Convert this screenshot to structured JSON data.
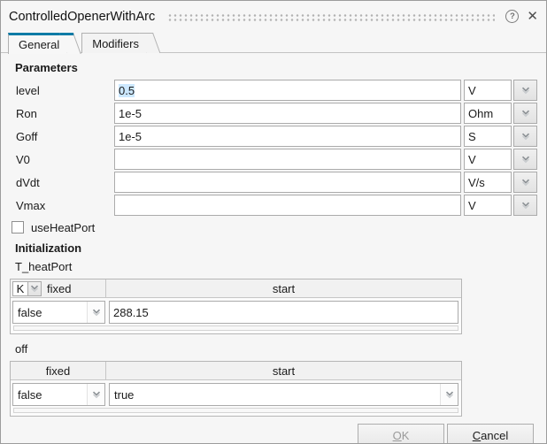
{
  "window": {
    "title": "ControlledOpenerWithArc"
  },
  "icons": {
    "help": "?",
    "close": "✕"
  },
  "tabs": {
    "general": "General",
    "modifiers": "Modifiers"
  },
  "sections": {
    "parameters": "Parameters",
    "initialization": "Initialization"
  },
  "params": [
    {
      "label": "level",
      "value": "0.5",
      "unit": "V",
      "value_selected": true
    },
    {
      "label": "Ron",
      "value": "1e-5",
      "unit": "Ohm",
      "value_selected": false
    },
    {
      "label": "Goff",
      "value": "1e-5",
      "unit": "S",
      "value_selected": false
    },
    {
      "label": "V0",
      "value": "",
      "unit": "V",
      "value_selected": false
    },
    {
      "label": "dVdt",
      "value": "",
      "unit": "V/s",
      "value_selected": false
    },
    {
      "label": "Vmax",
      "value": "",
      "unit": "V",
      "value_selected": false
    }
  ],
  "use_heat_port": {
    "label": "useHeatPort",
    "checked": false
  },
  "t_heat_port": {
    "label": "T_heatPort",
    "unit": "K",
    "col_fixed": "fixed",
    "col_start": "start",
    "fixed_value": "false",
    "start_value": "288.15"
  },
  "off_var": {
    "label": "off",
    "col_fixed": "fixed",
    "col_start": "start",
    "fixed_value": "false",
    "start_value": "true"
  },
  "buttons": {
    "ok": "OK",
    "cancel": "Cancel"
  },
  "colors": {
    "accent": "#0f7ba6",
    "selection": "#cce8ff"
  }
}
